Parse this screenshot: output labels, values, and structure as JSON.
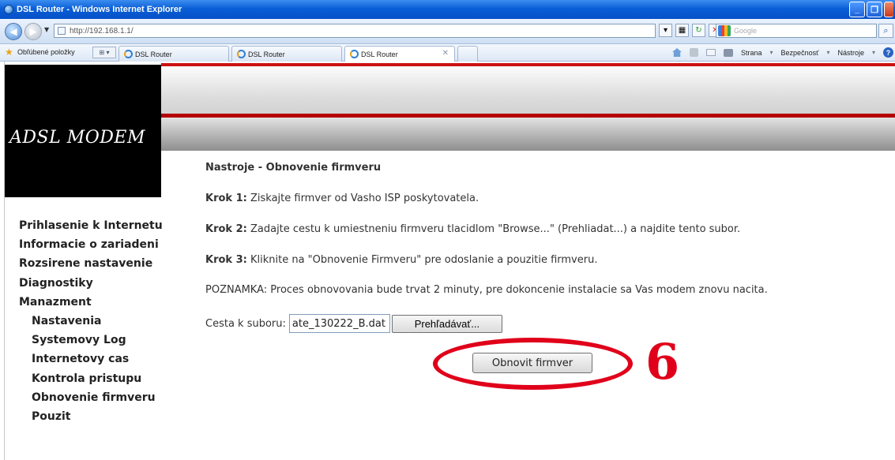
{
  "browser": {
    "window_title": "DSL Router - Windows Internet Explorer",
    "url": "http://192.168.1.1/",
    "search_placeholder": "Google",
    "favorites_label": "Obľúbené položky",
    "tabs": [
      {
        "label": "DSL Router"
      },
      {
        "label": "DSL Router"
      },
      {
        "label": "DSL Router"
      }
    ],
    "commands": {
      "page_label": "Strana",
      "safety_label": "Bezpečnosť",
      "tools_label": "Nástroje"
    }
  },
  "header": {
    "logo_text": "ADSL MODEM"
  },
  "sidebar": {
    "items": [
      {
        "label": "Prihlasenie k Internetu"
      },
      {
        "label": "Informacie o zariadeni"
      },
      {
        "label": "Rozsirene nastavenie"
      },
      {
        "label": "Diagnostiky"
      },
      {
        "label": "Manazment"
      },
      {
        "label": "Nastavenia"
      },
      {
        "label": "Systemovy Log"
      },
      {
        "label": "Internetovy cas"
      },
      {
        "label": "Kontrola pristupu"
      },
      {
        "label": "Obnovenie firmveru"
      },
      {
        "label": "Pouzit"
      }
    ]
  },
  "main": {
    "heading": "Nastroje - Obnovenie firmveru",
    "step1_label": "Krok 1:",
    "step1_text": "Ziskajte firmver od Vasho ISP poskytovatela.",
    "step2_label": "Krok 2:",
    "step2_text": "Zadajte cestu k umiestneniu firmveru tlacidlom \"Browse...\" (Prehliadat...) a najdite tento subor.",
    "step3_label": "Krok 3:",
    "step3_text": "Kliknite na \"Obnovenie Firmveru\" pre odoslanie a pouzitie firmveru.",
    "note": "POZNAMKA: Proces obnovovania bude trvat 2 minuty, pre dokoncenie instalacie sa Vas modem znovu nacita.",
    "path_label": "Cesta k suboru:",
    "path_value": "ate_130222_B.dat",
    "browse_label": "Prehľadávať...",
    "update_button": "Obnovit firmver"
  },
  "annotation": {
    "number": "6",
    "color": "#e0001a"
  }
}
